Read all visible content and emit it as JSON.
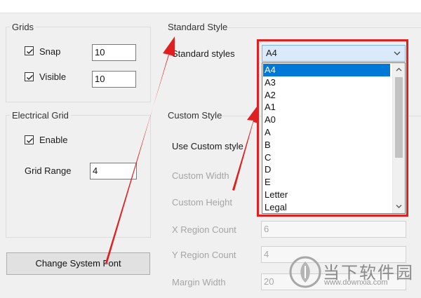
{
  "grids": {
    "legend": "Grids",
    "snap": {
      "label": "Snap",
      "checked": true,
      "value": "10"
    },
    "visible": {
      "label": "Visible",
      "checked": true,
      "value": "10"
    }
  },
  "electrical_grid": {
    "legend": "Electrical Grid",
    "enable": {
      "label": "Enable",
      "checked": true
    },
    "range": {
      "label": "Grid Range",
      "value": "4"
    }
  },
  "change_font_button": "Change System Font",
  "standard_style": {
    "legend": "Standard Style",
    "label": "Standard styles",
    "selected": "A4",
    "options": [
      "A4",
      "A3",
      "A2",
      "A1",
      "A0",
      "A",
      "B",
      "C",
      "D",
      "E",
      "Letter",
      "Legal"
    ]
  },
  "custom_style": {
    "legend": "Custom Style",
    "use_custom": "Use Custom style",
    "custom_width": {
      "label": "Custom Width"
    },
    "custom_height": {
      "label": "Custom Height"
    },
    "x_region_count": {
      "label": "X Region Count",
      "value": "6"
    },
    "y_region_count": {
      "label": "Y Region Count",
      "value": "4"
    },
    "margin_width": {
      "label": "Margin Width",
      "value": "20"
    }
  },
  "watermark": {
    "name": "当下软件园",
    "url": "www.downxia.com"
  },
  "colors": {
    "annotation_red": "#e02020",
    "selection_blue": "#0078d7"
  }
}
